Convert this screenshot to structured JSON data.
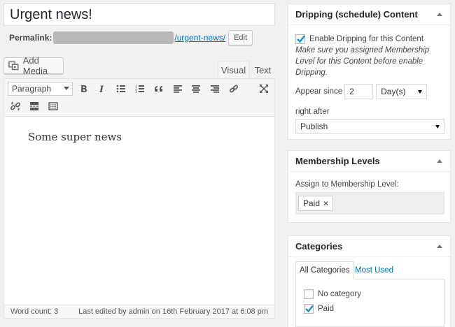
{
  "post": {
    "title": "Urgent news!",
    "permalink_label": "Permalink:",
    "permalink_slug": "/urgent-news/",
    "edit_label": "Edit"
  },
  "editor": {
    "add_media_label": "Add Media",
    "tab_visual": "Visual",
    "tab_text": "Text",
    "format_value": "Paragraph",
    "content": "Some super news",
    "word_count": "Word count: 3",
    "last_edited": "Last edited by admin on 16th February 2017 at 6:08 pm",
    "toolbar_icons": [
      "bold-icon",
      "italic-icon",
      "bullet-list-icon",
      "numbered-list-icon",
      "blockquote-icon",
      "align-left-icon",
      "align-center-icon",
      "align-right-icon",
      "link-icon",
      "fullscreen-icon",
      "unlink-icon",
      "read-more-icon",
      "toolbar-toggle-icon"
    ]
  },
  "dripping": {
    "title": "Dripping (schedule) Content",
    "enable_label": "Enable Dripping for this Content",
    "enable_checked": true,
    "note": "Make sure you assigned Membership Level for this Content before enable Dripping.",
    "appear_since_label": "Appear since",
    "appear_since_value": "2",
    "unit_value": "Day(s)",
    "right_after_label": "right after",
    "right_after_value": "Publish"
  },
  "membership": {
    "title": "Membership Levels",
    "assign_label": "Assign to Membership Level:",
    "tag": "Paid",
    "tag_remove": "×"
  },
  "categories": {
    "title": "Categories",
    "tab_all": "All Categories",
    "tab_most_used": "Most Used",
    "items": [
      {
        "label": "No category",
        "checked": false
      },
      {
        "label": "Paid",
        "checked": true
      }
    ]
  },
  "colors": {
    "link": "#0073aa",
    "check": "#1e8cbe"
  }
}
